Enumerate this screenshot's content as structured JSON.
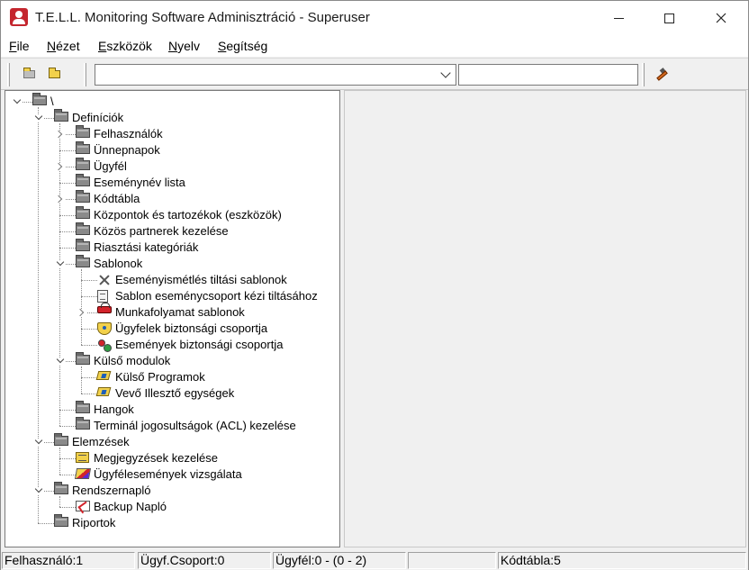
{
  "window": {
    "title": "T.E.L.L. Monitoring Software Adminisztráció - Superuser"
  },
  "menu": [
    {
      "accel": "F",
      "rest": "ile"
    },
    {
      "accel": "N",
      "rest": "ézet"
    },
    {
      "accel": "E",
      "rest": "szközök"
    },
    {
      "accel": "N",
      "rest": "yelv",
      "pre": ""
    },
    {
      "accel": "S",
      "rest": "egítség"
    }
  ],
  "toolbar": {
    "combo_value": "",
    "text_value": ""
  },
  "tree": [
    {
      "label": "\\",
      "icon": "folder-icon",
      "level": 0,
      "expander": "open"
    },
    {
      "label": "Definíciók",
      "icon": "folder-icon",
      "level": 1,
      "expander": "open"
    },
    {
      "label": "Felhasználók",
      "icon": "folder-icon",
      "level": 2,
      "expander": "closed"
    },
    {
      "label": "Ünnepnapok",
      "icon": "folder-icon",
      "level": 2,
      "expander": ""
    },
    {
      "label": "Ügyfél",
      "icon": "folder-icon",
      "level": 2,
      "expander": "closed"
    },
    {
      "label": "Eseménynév lista",
      "icon": "folder-icon",
      "level": 2,
      "expander": ""
    },
    {
      "label": "Kódtábla",
      "icon": "folder-icon",
      "level": 2,
      "expander": "closed"
    },
    {
      "label": "Központok és tartozékok (eszközök)",
      "icon": "folder-icon",
      "level": 2,
      "expander": ""
    },
    {
      "label": "Közös partnerek kezelése",
      "icon": "folder-icon",
      "level": 2,
      "expander": ""
    },
    {
      "label": "Riasztási kategóriák",
      "icon": "folder-icon",
      "level": 2,
      "expander": ""
    },
    {
      "label": "Sablonok",
      "icon": "folder-icon",
      "level": 2,
      "expander": "open"
    },
    {
      "label": "Eseményismétlés tiltási sablonok",
      "icon": "x-icon",
      "level": 3,
      "expander": ""
    },
    {
      "label": "Sablon eseménycsoport kézi tiltásához",
      "icon": "document-icon",
      "level": 3,
      "expander": ""
    },
    {
      "label": "Munkafolyamat sablonok",
      "icon": "workflow-icon",
      "level": 3,
      "expander": "closed"
    },
    {
      "label": "Ügyfelek biztonsági csoportja",
      "icon": "shield-icon",
      "level": 3,
      "expander": ""
    },
    {
      "label": "Események biztonsági csoportja",
      "icon": "people-icon",
      "level": 3,
      "expander": ""
    },
    {
      "label": "Külső modulok",
      "icon": "folder-icon",
      "level": 2,
      "expander": "open"
    },
    {
      "label": "Külső Programok",
      "icon": "program-icon",
      "level": 3,
      "expander": ""
    },
    {
      "label": "Vevő Illesztő egységek",
      "icon": "receiver-icon",
      "level": 3,
      "expander": ""
    },
    {
      "label": "Hangok",
      "icon": "folder-icon",
      "level": 2,
      "expander": ""
    },
    {
      "label": "Terminál jogosultságok (ACL) kezelése",
      "icon": "folder-icon",
      "level": 2,
      "expander": ""
    },
    {
      "label": "Elemzések",
      "icon": "folder-icon",
      "level": 1,
      "expander": "open"
    },
    {
      "label": "Megjegyzések kezelése",
      "icon": "note-icon",
      "level": 2,
      "expander": ""
    },
    {
      "label": "Ügyfélesemények vizsgálata",
      "icon": "pencil-icon",
      "level": 2,
      "expander": ""
    },
    {
      "label": "Rendszernapló",
      "icon": "folder-icon",
      "level": 1,
      "expander": "open"
    },
    {
      "label": "Backup Napló",
      "icon": "log-icon",
      "level": 2,
      "expander": ""
    },
    {
      "label": "Riportok",
      "icon": "folder-icon",
      "level": 1,
      "expander": ""
    }
  ],
  "status": {
    "user": "Felhasználó:1",
    "group": "Ügyf.Csoport:0",
    "client": "Ügyfél:0 - (0 - 2)",
    "blank": "",
    "codetable": "Kódtábla:5"
  }
}
